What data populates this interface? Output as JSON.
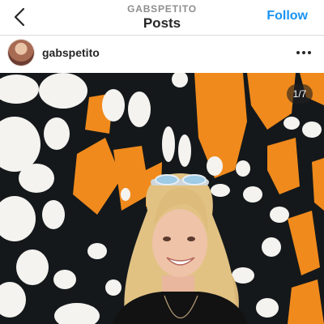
{
  "header": {
    "subtitle": "GABSPETITO",
    "title": "Posts",
    "follow_label": "Follow",
    "back_icon": "chevron-left-icon"
  },
  "post": {
    "username": "gabspetito",
    "more_icon": "ellipsis-icon",
    "image_counter": "1/7",
    "image_description_colors": {
      "wing_orange": "#f08a1c",
      "wing_black": "#14181b",
      "dot_white": "#f4f3ef"
    }
  },
  "colors": {
    "accent": "#1893f1",
    "text": "#262626",
    "muted": "#8e8e8e"
  }
}
